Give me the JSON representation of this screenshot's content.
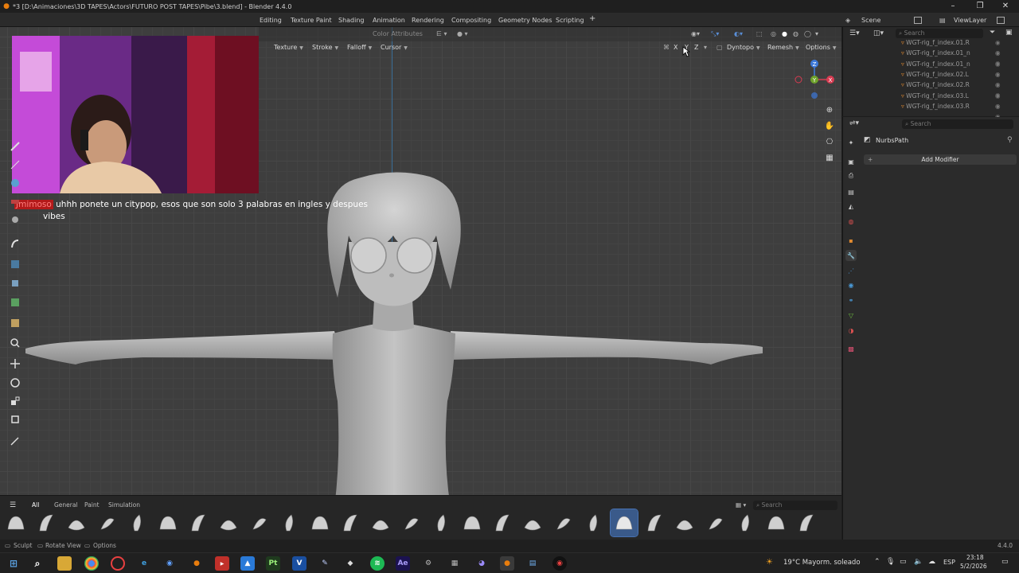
{
  "titlebar": {
    "title": "*3 [D:\\Animaciones\\3D TAPES\\Actors\\FUTURO POST TAPES\\Pibe\\3.blend] - Blender 4.4.0",
    "minimize": "–",
    "maximize": "❐",
    "close": "✕"
  },
  "topbar": {
    "workspaces": [
      "Editing",
      "Texture Paint",
      "Shading",
      "Animation",
      "Rendering",
      "Compositing",
      "Geometry Nodes",
      "Scripting"
    ],
    "add_tab": "+",
    "scene_label": "Scene",
    "viewlayer_label": "ViewLayer"
  },
  "viewport_header": {
    "color_attributes": "Color Attributes",
    "menus": [
      "Texture",
      "Stroke",
      "Falloff",
      "Cursor"
    ],
    "mirror_axes": [
      "X",
      "Y",
      "Z"
    ],
    "dyntopo": "Dyntopo",
    "remesh": "Remesh",
    "options": "Options"
  },
  "chat": {
    "username": "Jmimoso",
    "message_line1": "uhhh ponete un citypop, esos que son solo 3 palabras en ingles y despues",
    "message_line2": "vibes"
  },
  "gizmo": {
    "z": "Z",
    "y": "Y",
    "x": "X"
  },
  "shelf": {
    "tabs": [
      "All",
      "General",
      "Paint",
      "Simulation"
    ],
    "search_placeholder": "Search",
    "brush_count": 27,
    "active_brush_index": 20
  },
  "outliner": {
    "search_placeholder": "Search",
    "rows": [
      "WGT-rig_f_index.01.R",
      "WGT-rig_f_index.01_n",
      "WGT-rig_f_index.01_n",
      "WGT-rig_f_index.02.L",
      "WGT-rig_f_index.02.R",
      "WGT-rig_f_index.03.L",
      "WGT-rig_f_index.03.R"
    ]
  },
  "properties": {
    "search_placeholder": "Search",
    "object_name": "NurbsPath",
    "add_modifier": "Add Modifier"
  },
  "statusbar": {
    "mode": "Sculpt",
    "rotate": "Rotate View",
    "options": "Options",
    "version": "4.4.0"
  },
  "taskbar": {
    "weather": "19°C  Mayorm. soleado",
    "language": "ESP",
    "time": "23:18",
    "date": "5/2/2026"
  },
  "colors": {
    "accent": "#4772b3",
    "axis_x": "#d83c52",
    "axis_y": "#6fa32b",
    "axis_z": "#3c78d8"
  }
}
